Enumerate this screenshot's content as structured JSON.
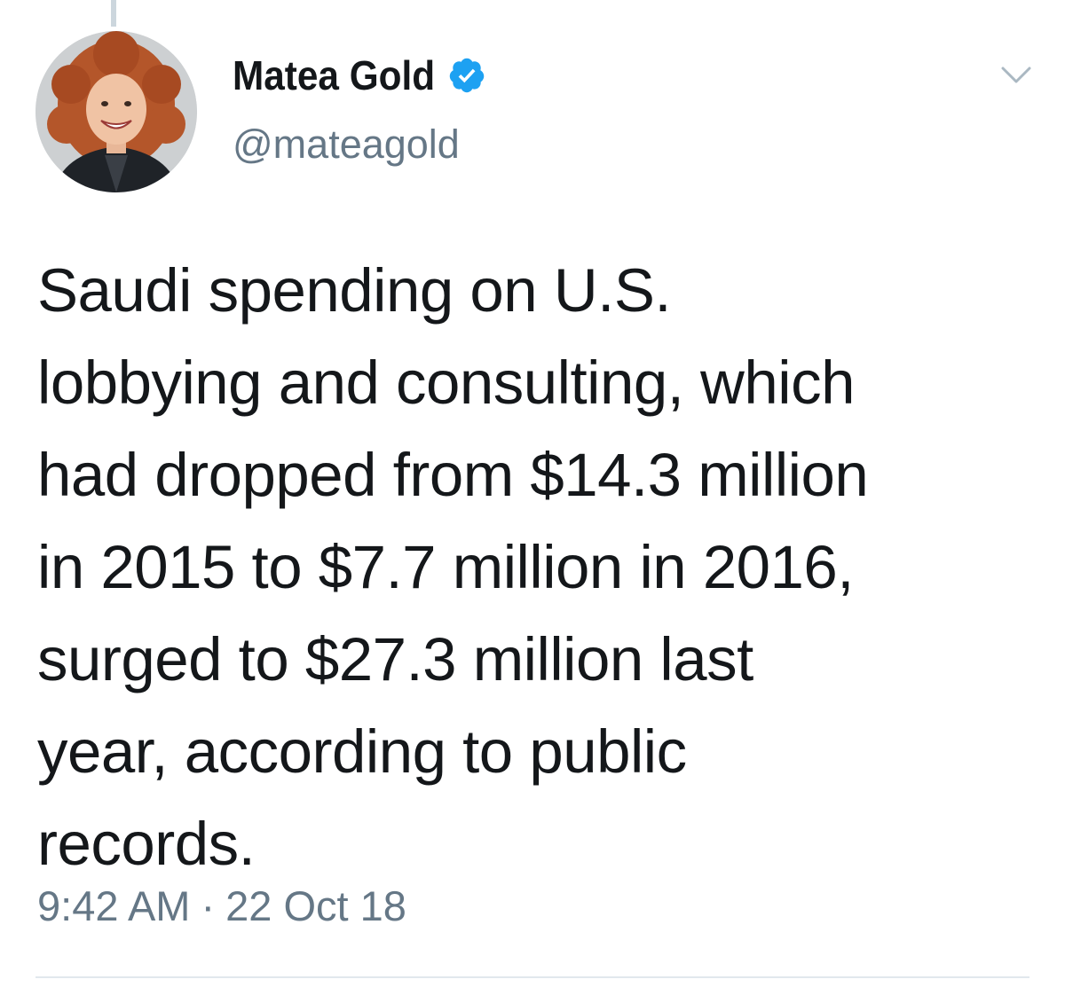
{
  "tweet": {
    "author": {
      "display_name": "Matea Gold",
      "handle": "@mateagold",
      "verified": true,
      "verified_icon": "verified-badge-icon",
      "avatar_icon": "profile-photo"
    },
    "text": "Saudi spending on U.S.\nlobbying and consulting, which\nhad dropped from $14.3 million\nin 2015 to $7.7 million in 2016,\nsurged to $27.3 million last\nyear, according to public\nrecords.",
    "time": "9:42 AM",
    "separator": "·",
    "date": "22 Oct 18",
    "menu_icon": "chevron-down-icon"
  },
  "colors": {
    "text_primary": "#14171a",
    "text_secondary": "#657786",
    "verified_blue": "#1da1f2",
    "divider": "#e1e8ed",
    "thread_line": "#ccd6dd"
  }
}
